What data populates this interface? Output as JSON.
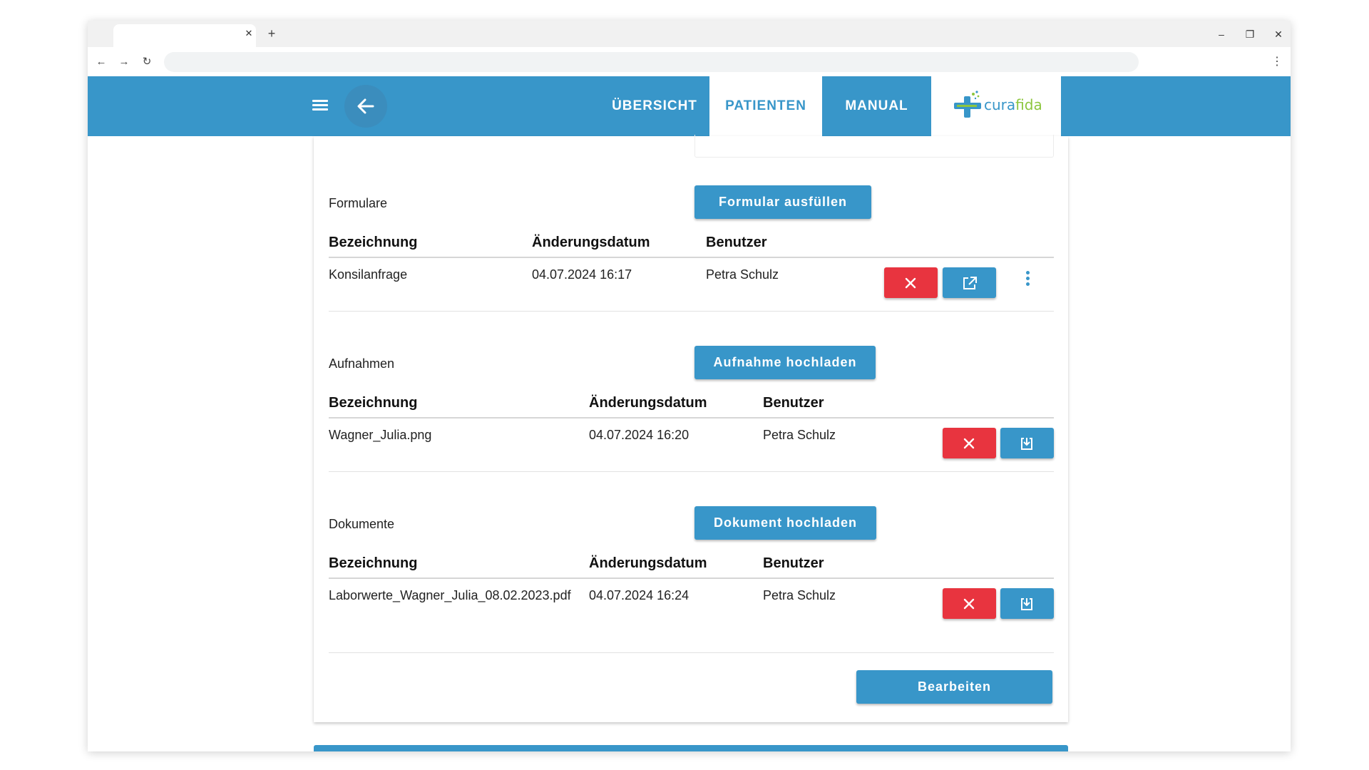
{
  "nav": {
    "tabs": [
      "ÜBERSICHT",
      "PATIENTEN",
      "MANUAL"
    ],
    "logo": {
      "part1": "cura",
      "part2": "fida"
    }
  },
  "forms": {
    "label": "Formulare",
    "button": "Formular ausfüllen",
    "headers": [
      "Bezeichnung",
      "Änderungsdatum",
      "Benutzer"
    ],
    "rows": [
      {
        "name": "Konsilanfrage",
        "date": "04.07.2024 16:17",
        "user": "Petra Schulz"
      }
    ]
  },
  "recordings": {
    "label": "Aufnahmen",
    "button": "Aufnahme hochladen",
    "headers": [
      "Bezeichnung",
      "Änderungsdatum",
      "Benutzer"
    ],
    "rows": [
      {
        "name": "Wagner_Julia.png",
        "date": "04.07.2024 16:20",
        "user": "Petra Schulz"
      }
    ]
  },
  "documents": {
    "label": "Dokumente",
    "button": "Dokument hochladen",
    "headers": [
      "Bezeichnung",
      "Änderungsdatum",
      "Benutzer"
    ],
    "rows": [
      {
        "name": "Laborwerte_Wagner_Julia_08.02.2023.pdf",
        "date": "04.07.2024 16:24",
        "user": "Petra Schulz"
      }
    ]
  },
  "actions": {
    "edit": "Bearbeiten"
  },
  "icons": {
    "delete": "close-icon",
    "open": "open-external-icon",
    "download": "download-icon",
    "more": "more-vert-icon",
    "menu": "menu-icon",
    "back": "arrow-left-icon"
  },
  "colors": {
    "primary": "#3896c9",
    "danger": "#e8343f",
    "accent": "#8dc63f"
  }
}
